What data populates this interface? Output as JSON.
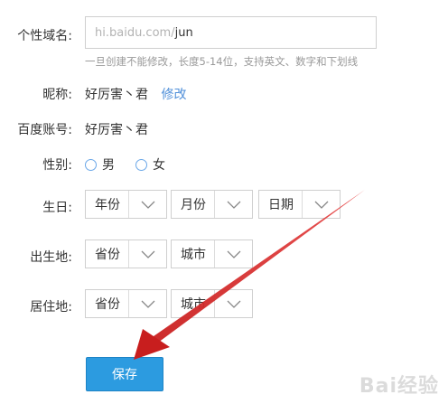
{
  "form": {
    "domain": {
      "label": "个性域名:",
      "prefix": "hi.baidu.com/",
      "value": "jun",
      "hint": "一旦创建不能修改，长度5-14位，支持英文、数字和下划线"
    },
    "nickname": {
      "label": "昵称:",
      "value": "好厉害丶君",
      "edit_link": "修改"
    },
    "account": {
      "label": "百度账号:",
      "value": "好厉害丶君"
    },
    "gender": {
      "label": "性别:",
      "options": [
        "男",
        "女"
      ]
    },
    "birthday": {
      "label": "生日:",
      "year": "年份",
      "month": "月份",
      "day": "日期"
    },
    "birthplace": {
      "label": "出生地:",
      "province": "省份",
      "city": "城市"
    },
    "residence": {
      "label": "居住地:",
      "province": "省份",
      "city": "城市"
    },
    "save_label": "保存"
  },
  "watermark": {
    "text": "Bai经验"
  },
  "colors": {
    "primary": "#2c9be0",
    "arrow": "#d42a2a",
    "link": "#4f8fd9"
  }
}
